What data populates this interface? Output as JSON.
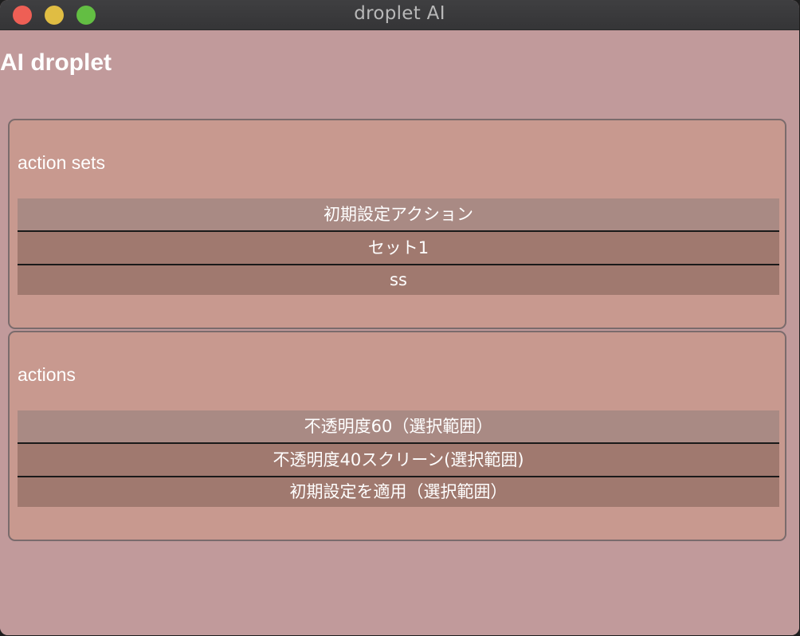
{
  "window": {
    "title": "droplet AI"
  },
  "app": {
    "title": "AI droplet"
  },
  "action_sets": {
    "label": "action sets",
    "items": [
      {
        "label": "初期設定アクション"
      },
      {
        "label": "セット1"
      },
      {
        "label": "ss"
      }
    ]
  },
  "actions": {
    "label": "actions",
    "items": [
      {
        "label": "不透明度60（選択範囲）"
      },
      {
        "label": "不透明度40スクリーン(選択範囲)"
      },
      {
        "label": "初期設定を適用（選択範囲）"
      }
    ]
  },
  "colors": {
    "window_bg": "#c19a9b",
    "panel_bg": "#c8998f",
    "item_bg": "#a0796f",
    "item_selected_bg": "#a98a84",
    "close": "#ee5f55",
    "minimize": "#e0bd43",
    "zoom": "#63be43"
  }
}
